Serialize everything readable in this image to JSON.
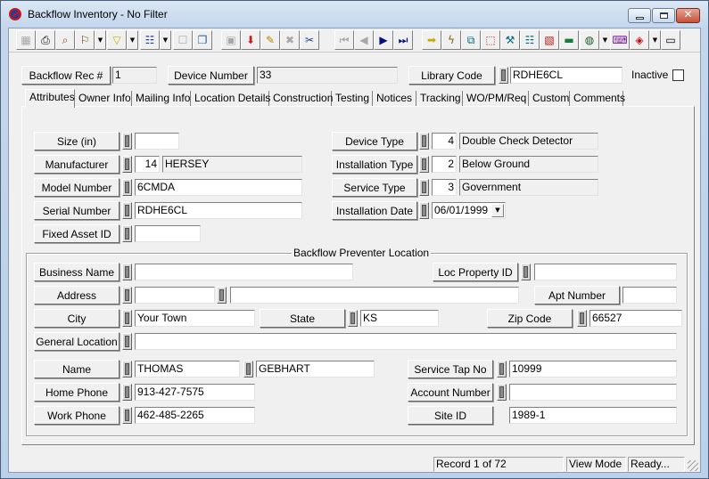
{
  "window": {
    "title": "Backflow Inventory - No Filter",
    "controls": {
      "minimize": "–",
      "maximize": "□",
      "close": "✕"
    }
  },
  "toolbar": {
    "buttons": [
      {
        "name": "view-toggle",
        "icon": "▦",
        "enabled": false
      },
      {
        "name": "print",
        "icon": "⎙",
        "enabled": true
      },
      {
        "name": "print-preview",
        "icon": "⌕",
        "enabled": true
      },
      {
        "name": "find",
        "icon": "⚐",
        "enabled": true,
        "dropdown": true
      },
      {
        "name": "filter",
        "icon": "▽",
        "enabled": true,
        "dropdown": true
      },
      {
        "name": "report",
        "icon": "☷",
        "enabled": true,
        "dropdown": true
      },
      {
        "name": "properties",
        "icon": "☐",
        "enabled": false
      },
      {
        "name": "copy-record",
        "icon": "❐",
        "enabled": true
      },
      {
        "name": "save",
        "icon": "▣",
        "enabled": false
      },
      {
        "name": "add-record",
        "icon": "⬇",
        "enabled": true
      },
      {
        "name": "edit",
        "icon": "✎",
        "enabled": true
      },
      {
        "name": "delete",
        "icon": "✖",
        "enabled": false
      },
      {
        "name": "cut",
        "icon": "✂",
        "enabled": true
      },
      {
        "name": "first-record",
        "icon": "⏮",
        "enabled": false
      },
      {
        "name": "previous-record",
        "icon": "◀",
        "enabled": false
      },
      {
        "name": "next-record",
        "icon": "▶",
        "enabled": true
      },
      {
        "name": "last-record",
        "icon": "⏭",
        "enabled": true
      },
      {
        "name": "go-to",
        "icon": "➡",
        "enabled": true
      },
      {
        "name": "quick-action",
        "icon": "ϟ",
        "enabled": true
      },
      {
        "name": "related",
        "icon": "⧉",
        "enabled": true
      },
      {
        "name": "hierarchy",
        "icon": "⬚",
        "enabled": true
      },
      {
        "name": "work-order",
        "icon": "⚒",
        "enabled": true
      },
      {
        "name": "calendar",
        "icon": "☷",
        "enabled": true
      },
      {
        "name": "map-view",
        "icon": "▧",
        "enabled": true
      },
      {
        "name": "toolbox",
        "icon": "▬",
        "enabled": true
      },
      {
        "name": "gis-globe",
        "icon": "◍",
        "enabled": true,
        "dropdown": true
      },
      {
        "name": "keyboard",
        "icon": "⌨",
        "enabled": true
      },
      {
        "name": "help-book",
        "icon": "◈",
        "enabled": true,
        "dropdown": true
      },
      {
        "name": "exit",
        "icon": "▭",
        "enabled": true
      }
    ]
  },
  "header": {
    "backflow_rec_label": "Backflow Rec #",
    "backflow_rec_value": "1",
    "device_number_label": "Device Number",
    "device_number_value": "33",
    "library_code_label": "Library Code",
    "library_code_value": "RDHE6CL",
    "inactive_label": "Inactive",
    "inactive_checked": false
  },
  "tabs": [
    {
      "label": "Attributes",
      "active": true
    },
    {
      "label": "Owner Info",
      "active": false
    },
    {
      "label": "Mailing Info",
      "active": false
    },
    {
      "label": "Location Details",
      "active": false
    },
    {
      "label": "Construction",
      "active": false
    },
    {
      "label": "Testing",
      "active": false
    },
    {
      "label": "Notices",
      "active": false
    },
    {
      "label": "Tracking",
      "active": false
    },
    {
      "label": "WO/PM/Req",
      "active": false
    },
    {
      "label": "Custom",
      "active": false
    },
    {
      "label": "Comments",
      "active": false
    }
  ],
  "attributes": {
    "size": {
      "label": "Size (in)",
      "value": ""
    },
    "manufacturer": {
      "label": "Manufacturer",
      "code": "14",
      "value": "HERSEY"
    },
    "model_number": {
      "label": "Model Number",
      "value": "6CMDA"
    },
    "serial_number": {
      "label": "Serial Number",
      "value": "RDHE6CL"
    },
    "fixed_asset_id": {
      "label": "Fixed Asset ID",
      "value": ""
    },
    "device_type": {
      "label": "Device Type",
      "code": "4",
      "value": "Double Check Detector"
    },
    "installation_type": {
      "label": "Installation Type",
      "code": "2",
      "value": "Below Ground"
    },
    "service_type": {
      "label": "Service Type",
      "code": "3",
      "value": "Government"
    },
    "installation_date": {
      "label": "Installation Date",
      "value": "06/01/1999",
      "dropdown_icon": "▼"
    }
  },
  "location": {
    "group_title": "Backflow Preventer Location",
    "business_name": {
      "label": "Business Name",
      "value": ""
    },
    "loc_property_id": {
      "label": "Loc Property ID",
      "value": ""
    },
    "address": {
      "label": "Address",
      "number": "",
      "street": ""
    },
    "apt_number": {
      "label": "Apt Number",
      "value": ""
    },
    "city": {
      "label": "City",
      "value": "Your Town"
    },
    "state": {
      "label": "State",
      "value": "KS"
    },
    "zip_code": {
      "label": "Zip Code",
      "value": "66527"
    },
    "general_location": {
      "label": "General Location",
      "value": ""
    },
    "name": {
      "label": "Name",
      "first": "THOMAS",
      "last": "GEBHART"
    },
    "service_tap_no": {
      "label": "Service Tap No",
      "value": "10999"
    },
    "home_phone": {
      "label": "Home Phone",
      "value": "913-427-7575"
    },
    "account_number": {
      "label": "Account Number",
      "value": ""
    },
    "work_phone": {
      "label": "Work Phone",
      "value": "462-485-2265"
    },
    "site_id": {
      "label": "Site ID",
      "value": "1989-1"
    }
  },
  "status": {
    "record": "Record 1 of 72",
    "mode": "View Mode",
    "state": "Ready..."
  }
}
